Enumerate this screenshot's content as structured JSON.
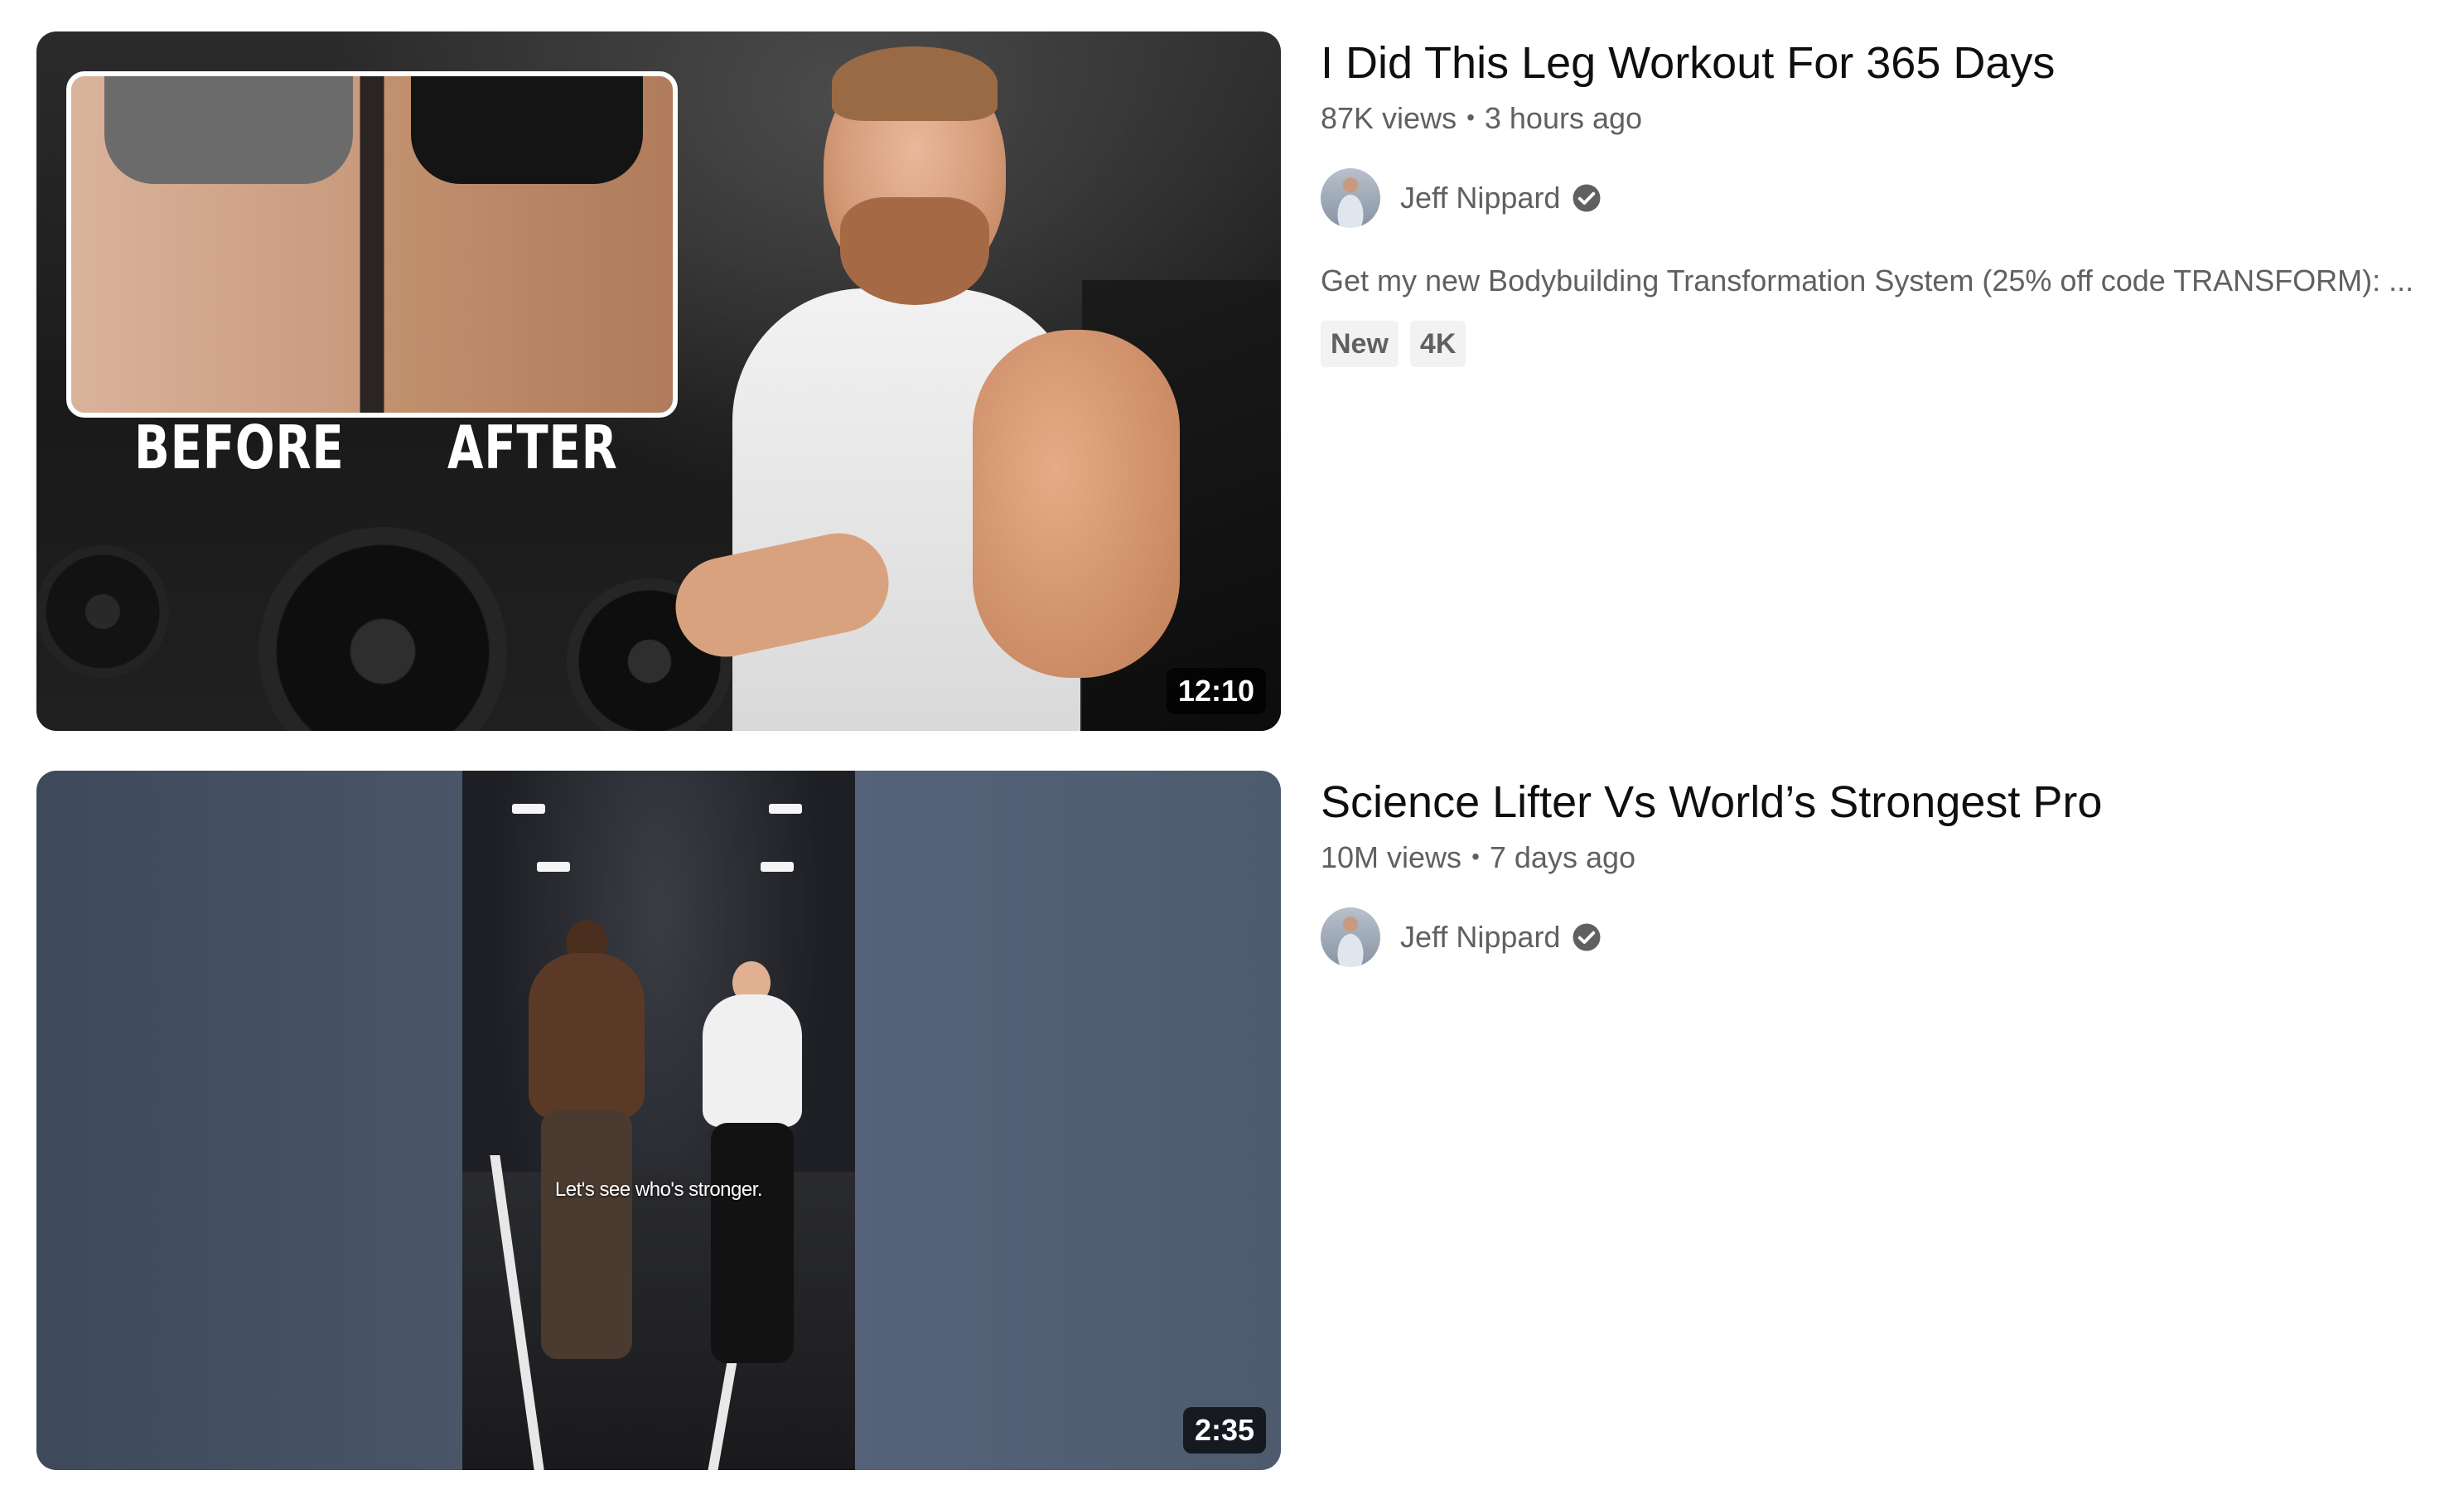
{
  "videos": [
    {
      "title": "I Did This Leg Workout For 365 Days",
      "views": "87K views",
      "separator": "•",
      "age": "3 hours ago",
      "channel": "Jeff Nippard",
      "verified_icon": "check-circle-icon",
      "description": "Get my new Bodybuilding Transformation System (25% off code TRANSFORM): ...",
      "badges": [
        "New",
        "4K"
      ],
      "duration": "12:10",
      "thumbnail_text": {
        "before": "BEFORE",
        "after": "AFTER"
      }
    },
    {
      "title": "Science Lifter Vs World’s Strongest Pro",
      "views": "10M views",
      "separator": "•",
      "age": "7 days ago",
      "channel": "Jeff Nippard",
      "verified_icon": "check-circle-icon",
      "duration": "2:35",
      "thumbnail_text": {
        "caption": "Let's see who's stronger."
      }
    }
  ],
  "colors": {
    "text_primary": "#0f0f0f",
    "text_secondary": "#606060",
    "badge_bg": "#f2f2f2",
    "duration_bg": "#000000"
  }
}
